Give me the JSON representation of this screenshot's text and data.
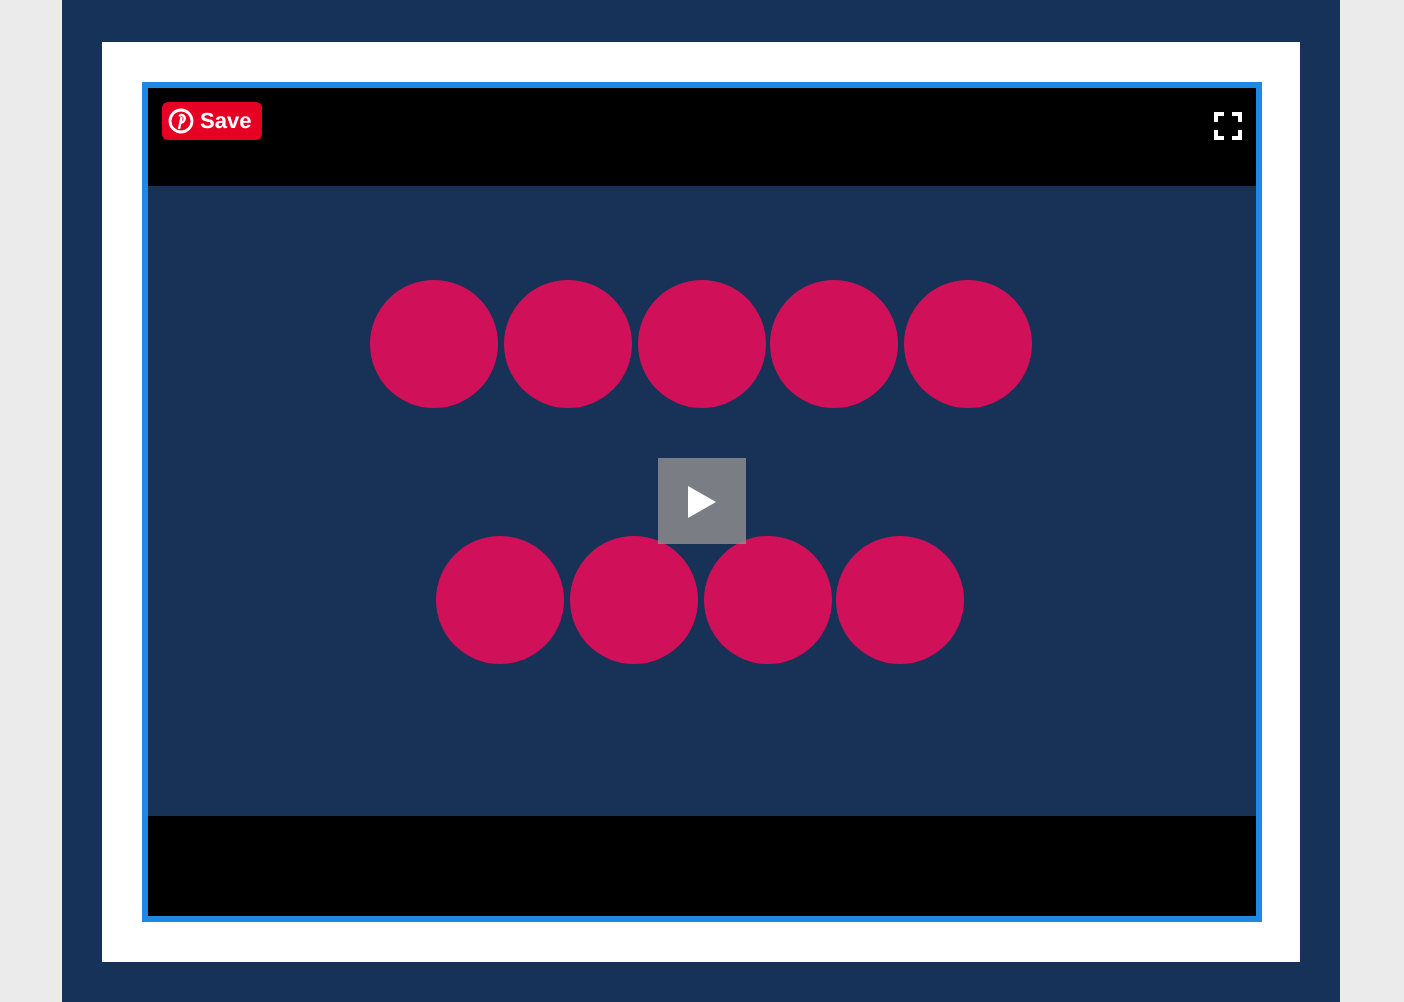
{
  "video_player": {
    "kind": "picture",
    "save_button": {
      "label": "Save"
    }
  }
}
